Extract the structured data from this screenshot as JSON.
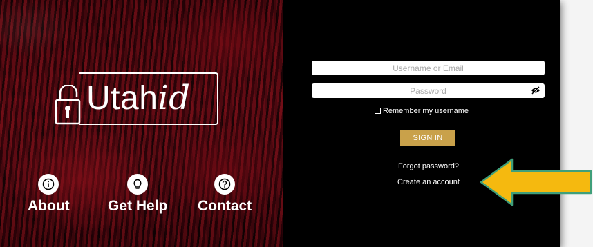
{
  "brand": {
    "logo_text": "Utah",
    "logo_text_italic": "id"
  },
  "nav": [
    {
      "label": "About",
      "icon": "info-icon"
    },
    {
      "label": "Get Help",
      "icon": "lightbulb-icon"
    },
    {
      "label": "Contact",
      "icon": "question-icon"
    }
  ],
  "login": {
    "username_placeholder": "Username or Email",
    "password_placeholder": "Password",
    "remember_label": "Remember my username",
    "signin_label": "SIGN IN",
    "forgot_label": "Forgot password?",
    "create_label": "Create an account"
  },
  "colors": {
    "background": "#000000",
    "accent_gold": "#c9a14a",
    "arrow_fill": "#f5b90f",
    "arrow_outline": "#3f9f7a"
  }
}
